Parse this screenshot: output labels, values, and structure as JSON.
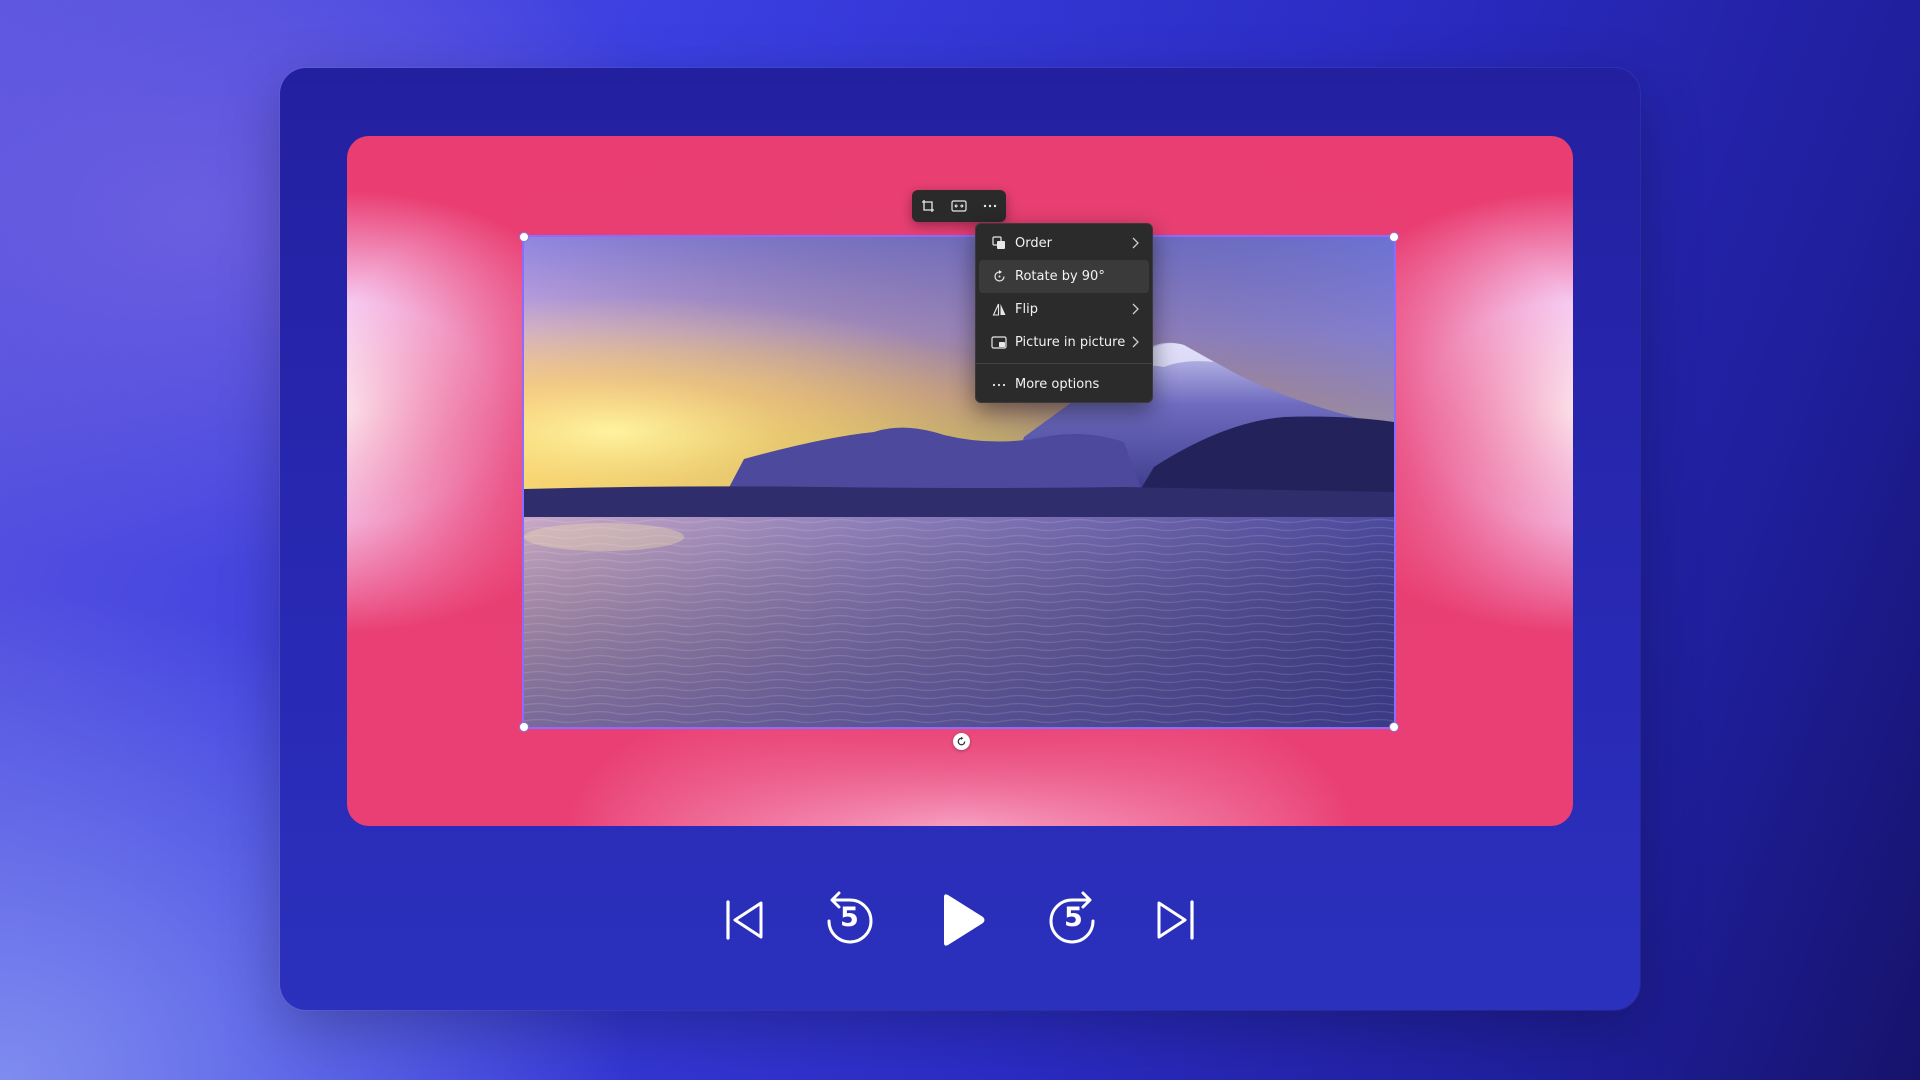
{
  "context_menu": {
    "items": [
      {
        "label": "Order",
        "icon": "order-icon",
        "has_submenu": true
      },
      {
        "label": "Rotate by 90°",
        "icon": "rotate-icon",
        "has_submenu": false
      },
      {
        "label": "Flip",
        "icon": "flip-icon",
        "has_submenu": true
      },
      {
        "label": "Picture in picture",
        "icon": "picture-in-picture-icon",
        "has_submenu": true
      },
      {
        "label": "More options",
        "icon": "more-horizontal-icon",
        "has_submenu": false
      }
    ]
  },
  "toolbar": {
    "icons": [
      "crop-icon",
      "fit-icon",
      "more-icon"
    ]
  },
  "playback": {
    "skip_back_seconds": "5",
    "skip_forward_seconds": "5"
  },
  "colors": {
    "accent_selection": "#8b6cff",
    "canvas_pink": "#e93f74",
    "panel_blue": "#2827b2"
  }
}
